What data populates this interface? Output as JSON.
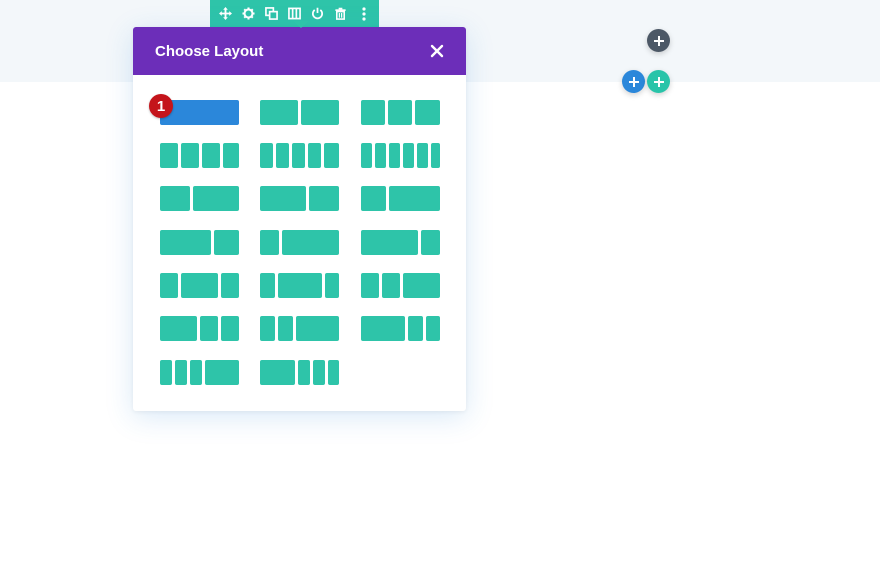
{
  "colors": {
    "toolbar": "#2ec4a9",
    "modal_header": "#6c2eb9",
    "layout_block": "#2ec4a9",
    "layout_selected": "#2b87da",
    "marker": "#c4141b",
    "add_dark": "#4c5866",
    "add_blue": "#2b87da",
    "add_teal": "#29c4a9"
  },
  "toolbar": {
    "icons": [
      "move-icon",
      "gear-icon",
      "duplicate-icon",
      "columns-icon",
      "power-icon",
      "trash-icon",
      "more-icon"
    ],
    "active": "columns-icon"
  },
  "modal": {
    "title": "Choose Layout",
    "close_icon": "close-icon"
  },
  "marker": {
    "label": "1"
  },
  "layouts": [
    {
      "id": "1",
      "cols": [
        1
      ],
      "selected": true
    },
    {
      "id": "1_2,1_2",
      "cols": [
        1,
        1
      ]
    },
    {
      "id": "1_3,1_3,1_3",
      "cols": [
        1,
        1,
        1
      ]
    },
    {
      "id": "1_4x4",
      "cols": [
        1,
        1,
        1,
        1
      ]
    },
    {
      "id": "1_5x5",
      "cols": [
        1,
        1,
        1,
        1,
        1
      ]
    },
    {
      "id": "1_6x6",
      "cols": [
        1,
        1,
        1,
        1,
        1,
        1
      ]
    },
    {
      "id": "2_5,3_5",
      "cols": [
        2,
        3
      ]
    },
    {
      "id": "3_5,2_5",
      "cols": [
        3,
        2
      ]
    },
    {
      "id": "1_3,2_3",
      "cols": [
        1,
        2
      ]
    },
    {
      "id": "2_3,1_3",
      "cols": [
        2,
        1
      ]
    },
    {
      "id": "1_4,3_4",
      "cols": [
        1,
        3
      ]
    },
    {
      "id": "3_4,1_4",
      "cols": [
        3,
        1
      ]
    },
    {
      "id": "1_4,1_2,1_4",
      "cols": [
        1,
        2,
        1
      ]
    },
    {
      "id": "1_5,3_5,1_5",
      "cols": [
        1,
        3,
        1
      ]
    },
    {
      "id": "1_4,1_4,1_2",
      "cols": [
        1,
        1,
        2
      ]
    },
    {
      "id": "1_2,1_4,1_4",
      "cols": [
        2,
        1,
        1
      ]
    },
    {
      "id": "1_5,1_5,3_5",
      "cols": [
        1,
        1,
        3
      ]
    },
    {
      "id": "3_5,1_5,1_5",
      "cols": [
        3,
        1,
        1
      ]
    },
    {
      "id": "1_6,1_6,1_6,1_2",
      "cols": [
        1,
        1,
        1,
        3
      ]
    },
    {
      "id": "1_2,1_6,1_6,1_6",
      "cols": [
        3,
        1,
        1,
        1
      ]
    }
  ]
}
